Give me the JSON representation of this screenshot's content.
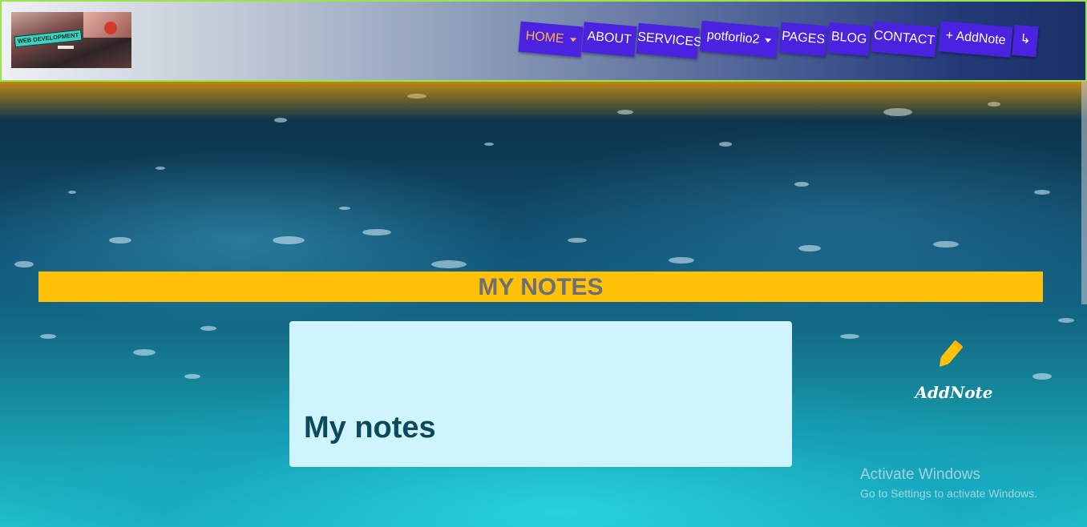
{
  "header": {
    "logo_text": "WEB DEVELOPMENT",
    "border_color": "#9be34b"
  },
  "nav": {
    "items": [
      {
        "label": "HOME",
        "active": true,
        "dropdown": true
      },
      {
        "label": "ABOUT",
        "active": false,
        "dropdown": false
      },
      {
        "label": "SERVICES",
        "active": false,
        "dropdown": false
      },
      {
        "label": "potforlio2",
        "active": false,
        "dropdown": true
      },
      {
        "label": "PAGES",
        "active": false,
        "dropdown": false
      },
      {
        "label": "BLOG",
        "active": false,
        "dropdown": false
      },
      {
        "label": "CONTACT",
        "active": false,
        "dropdown": false
      },
      {
        "label": "+ AddNote",
        "active": false,
        "dropdown": false
      }
    ],
    "logout_icon": "logout-arrow-icon",
    "item_color": "#4a22e0",
    "active_color": "#ffb347"
  },
  "main": {
    "section_title": "MY NOTES",
    "section_title_bg": "#ffc107",
    "card": {
      "title": "My notes",
      "bg": "#cff4fc"
    },
    "add_note": {
      "icon": "pencil-icon",
      "label": "AddNote"
    }
  },
  "watermark": {
    "title": "Activate Windows",
    "subtitle": "Go to Settings to activate Windows."
  }
}
